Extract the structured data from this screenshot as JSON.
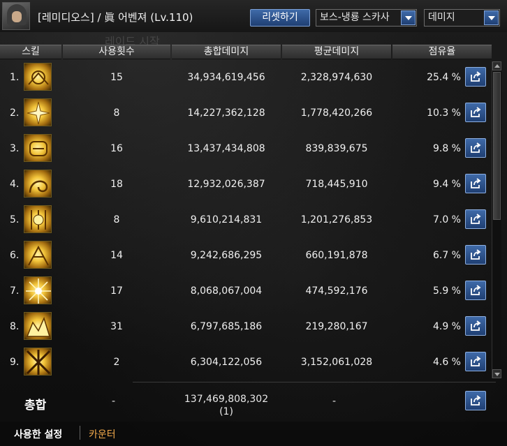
{
  "header": {
    "character": "[레미디오스] / 眞 어벤져 (Lv.110)",
    "reset_button": "리셋하기",
    "boss_select": "보스-냉룡 스카사",
    "metric_select": "데미지",
    "background_text": "레이드 시작"
  },
  "columns": [
    "스킬",
    "사용횟수",
    "총합데미지",
    "평균데미지",
    "점유율"
  ],
  "rows": [
    {
      "rank": "1.",
      "count": "15",
      "total": "34,934,619,456",
      "avg": "2,328,974,630",
      "share": "25.4 %",
      "icon": "skill-icon-1"
    },
    {
      "rank": "2.",
      "count": "8",
      "total": "14,227,362,128",
      "avg": "1,778,420,266",
      "share": "10.3 %",
      "icon": "skill-icon-2"
    },
    {
      "rank": "3.",
      "count": "16",
      "total": "13,437,434,808",
      "avg": "839,839,675",
      "share": "9.8 %",
      "icon": "skill-icon-3"
    },
    {
      "rank": "4.",
      "count": "18",
      "total": "12,932,026,387",
      "avg": "718,445,910",
      "share": "9.4 %",
      "icon": "skill-icon-4"
    },
    {
      "rank": "5.",
      "count": "8",
      "total": "9,610,214,831",
      "avg": "1,201,276,853",
      "share": "7.0 %",
      "icon": "skill-icon-5"
    },
    {
      "rank": "6.",
      "count": "14",
      "total": "9,242,686,295",
      "avg": "660,191,878",
      "share": "6.7 %",
      "icon": "skill-icon-6"
    },
    {
      "rank": "7.",
      "count": "17",
      "total": "8,068,067,004",
      "avg": "474,592,176",
      "share": "5.9 %",
      "icon": "skill-icon-7"
    },
    {
      "rank": "8.",
      "count": "31",
      "total": "6,797,685,186",
      "avg": "219,280,167",
      "share": "4.9 %",
      "icon": "skill-icon-8"
    },
    {
      "rank": "9.",
      "count": "2",
      "total": "6,304,122,056",
      "avg": "3,152,061,028",
      "share": "4.6 %",
      "icon": "skill-icon-9"
    }
  ],
  "total": {
    "label": "총합",
    "count": "-",
    "sum": "137,469,808,302",
    "sum_sub": "(1)",
    "avg": "-"
  },
  "tabs": {
    "used_settings": "사용한 설정",
    "counter": "카운터"
  },
  "colors": {
    "accent_blue": "#2f5a96",
    "counter_orange": "#f0a84a"
  }
}
